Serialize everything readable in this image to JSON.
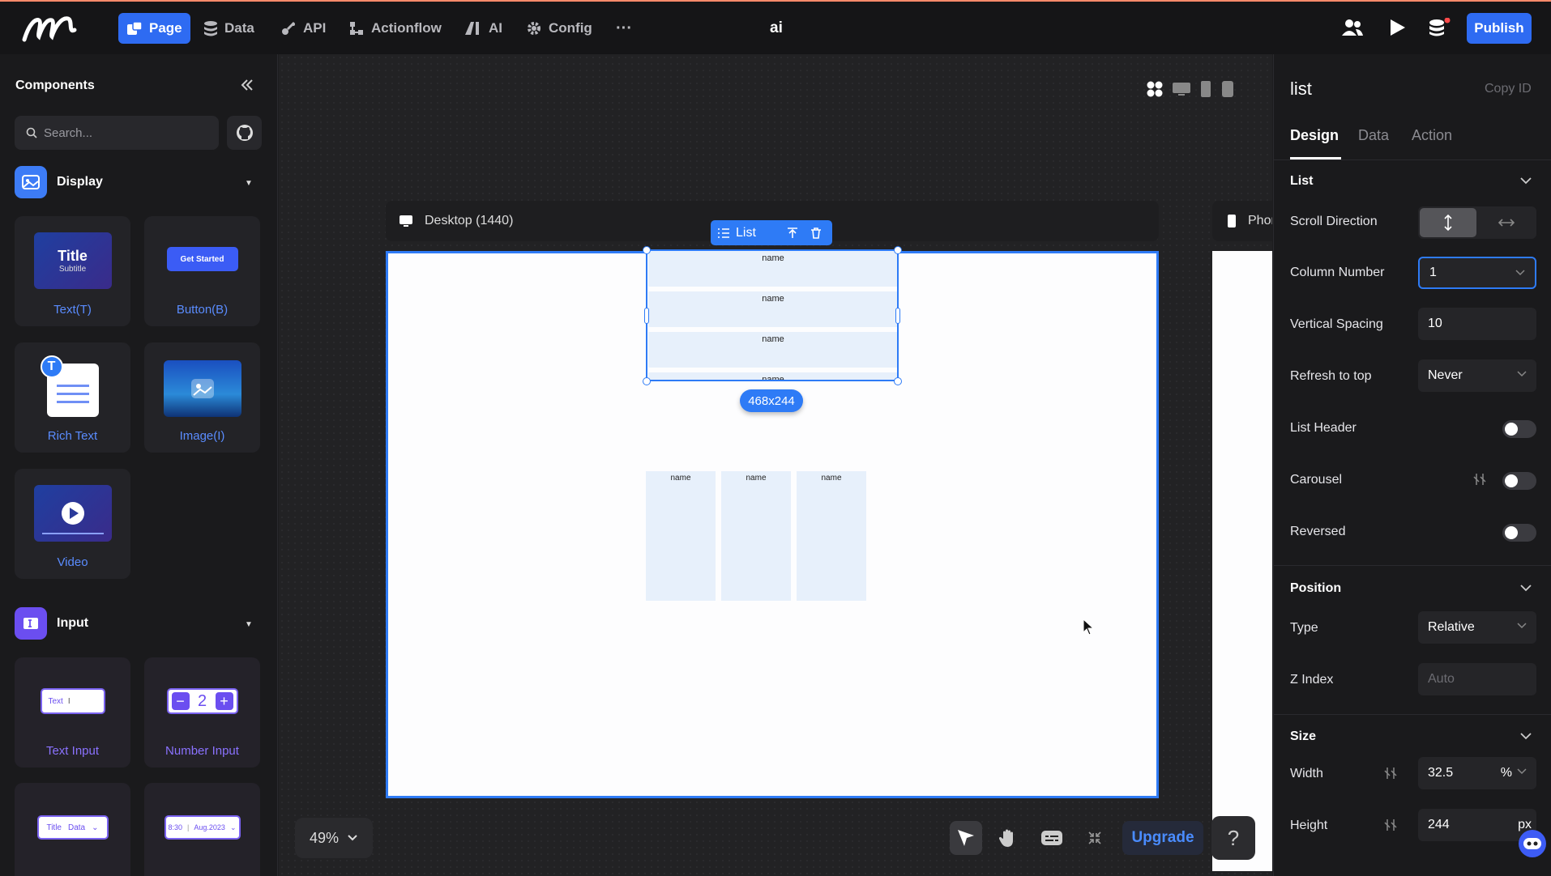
{
  "topbar": {
    "nav": [
      {
        "label": "Page",
        "icon": "page-icon",
        "active": true
      },
      {
        "label": "Data",
        "icon": "database-icon"
      },
      {
        "label": "API",
        "icon": "api-icon"
      },
      {
        "label": "Actionflow",
        "icon": "actionflow-icon"
      },
      {
        "label": "AI",
        "icon": "ai-icon"
      },
      {
        "label": "Config",
        "icon": "gear-icon"
      }
    ],
    "more": "···",
    "doc_title": "ai",
    "publish": "Publish"
  },
  "components": {
    "title": "Components",
    "search_placeholder": "Search...",
    "display": {
      "title": "Display",
      "items": [
        "Text(T)",
        "Button(B)",
        "Rich Text",
        "Image(I)",
        "Video"
      ]
    },
    "text_card": {
      "title": "Title",
      "subtitle": "Subtitle"
    },
    "button_card": {
      "label": "Get Started"
    },
    "richtext_badge": "T",
    "input": {
      "title": "Input",
      "items": [
        "Text Input",
        "Number Input"
      ]
    },
    "text_input_card": {
      "label": "Text"
    },
    "number_card": {
      "value": "2"
    },
    "select_card": {
      "a": "Title",
      "b": "Data"
    },
    "date_card": {
      "a": "8:30",
      "b": "Aug.2023"
    }
  },
  "canvas": {
    "desktop_label": "Desktop (1440)",
    "phone_label": "Phone",
    "list_toolbar": "List",
    "size_badge": "468x244",
    "item_name": "name",
    "rows": [
      "name",
      "name",
      "name",
      "name"
    ],
    "cols": [
      "name",
      "name",
      "name"
    ],
    "zoom": "49%",
    "upgrade": "Upgrade",
    "help": "?"
  },
  "inspector": {
    "title": "list",
    "copy_id": "Copy ID",
    "tabs": [
      "Design",
      "Data",
      "Action"
    ],
    "list_group": "List",
    "scroll_direction": "Scroll Direction",
    "column_number": {
      "label": "Column Number",
      "value": "1"
    },
    "vertical_spacing": {
      "label": "Vertical Spacing",
      "value": "10"
    },
    "refresh_to_top": {
      "label": "Refresh to top",
      "value": "Never"
    },
    "list_header": "List Header",
    "carousel": "Carousel",
    "reversed": "Reversed",
    "position_group": "Position",
    "type": {
      "label": "Type",
      "value": "Relative"
    },
    "z_index": {
      "label": "Z Index",
      "placeholder": "Auto"
    },
    "size_group": "Size",
    "width": {
      "label": "Width",
      "value": "32.5",
      "unit": "%"
    },
    "height": {
      "label": "Height",
      "value": "244",
      "unit": "px"
    }
  },
  "colors": {
    "accent": "#2e7bf6",
    "background": "#1c1c1e",
    "panel": "#1a1a1c"
  }
}
